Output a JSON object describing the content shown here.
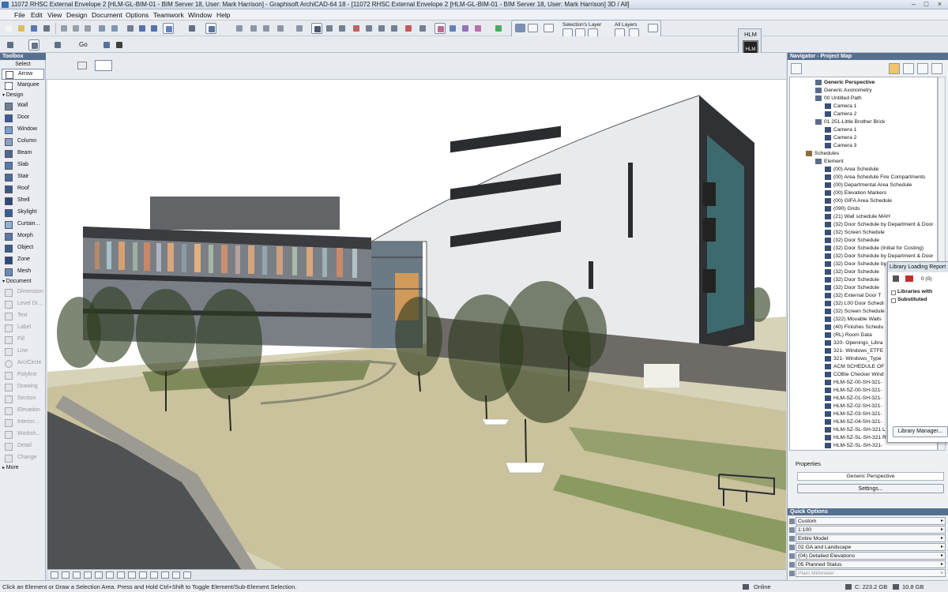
{
  "window": {
    "title": "11072 RHSC External Envelope 2 [HLM-GL-BIM-01 - BIM Server 18, User: Mark Harrison] - Graphisoft ArchiCAD-64 18 - [11072 RHSC External Envelope 2 [HLM-GL-BIM-01 - BIM Server 18, User: Mark Harrison] 3D / All]",
    "controls": [
      "–",
      "□",
      "×"
    ]
  },
  "menu": [
    "File",
    "Edit",
    "View",
    "Design",
    "Document",
    "Options",
    "Teamwork",
    "Window",
    "Help"
  ],
  "toolbar": {
    "go_label": "Go"
  },
  "layers": {
    "selections_layer": "Selection's Layer",
    "all_layers": "All Layers"
  },
  "company_badge": {
    "label": "HLM",
    "logo": "HLM"
  },
  "toolbox": {
    "header": "Toolbox",
    "select_label": "Select",
    "select_tools": [
      "Arrow",
      "Marquee"
    ],
    "design_label": "Design",
    "design_tools": [
      "Wall",
      "Door",
      "Window",
      "Column",
      "Beam",
      "Slab",
      "Stair",
      "Roof",
      "Shell",
      "Skylight",
      "Curtain...",
      "Morph",
      "Object",
      "Zone",
      "Mesh"
    ],
    "document_label": "Document",
    "document_tools": [
      "Dimension",
      "Level Di...",
      "Text",
      "Label",
      "Fill",
      "Line",
      "Arc/Circle",
      "Polyline",
      "Drawing",
      "Section",
      "Elevation",
      "Interior...",
      "Worksh...",
      "Detail",
      "Change"
    ],
    "more_label": "More"
  },
  "navigator": {
    "header": "Navigator - Project Map",
    "tree": [
      {
        "label": "Generic Perspective",
        "indent": 1,
        "bold": true
      },
      {
        "label": "Generic Axonometry",
        "indent": 1
      },
      {
        "label": "00 Untitled Path",
        "indent": 1
      },
      {
        "label": "Camera 1",
        "indent": 2
      },
      {
        "label": "Camera 2",
        "indent": 2
      },
      {
        "label": "01 251-Little Brother Brick",
        "indent": 1
      },
      {
        "label": "Camera 1",
        "indent": 2
      },
      {
        "label": "Camera 2",
        "indent": 2
      },
      {
        "label": "Camera 3",
        "indent": 2
      },
      {
        "label": "Schedules",
        "indent": 0
      },
      {
        "label": "Element",
        "indent": 1
      },
      {
        "label": "(00) Area Schedule",
        "indent": 2
      },
      {
        "label": "(00) Area Schedule Fire Compartments",
        "indent": 2
      },
      {
        "label": "(00) Departmental Area Schedule",
        "indent": 2
      },
      {
        "label": "(00) Elevation Markers",
        "indent": 2
      },
      {
        "label": "(00) GIFA Area Schedule",
        "indent": 2
      },
      {
        "label": "(090) Grids",
        "indent": 2
      },
      {
        "label": "(21) Wall schedule MAH",
        "indent": 2
      },
      {
        "label": "(32) Door Schedule by Department & Door",
        "indent": 2
      },
      {
        "label": "(32) Screen Schedule",
        "indent": 2
      },
      {
        "label": "(32) Door Schedule",
        "indent": 2
      },
      {
        "label": "(32) Door Schedule (Initial for Costing)",
        "indent": 2
      },
      {
        "label": "(32) Door Schedule by Department & Door",
        "indent": 2
      },
      {
        "label": "(32) Door Schedule by Door ID",
        "indent": 2
      },
      {
        "label": "(32) Door Schedule",
        "indent": 2
      },
      {
        "label": "(32) Door Schedule",
        "indent": 2
      },
      {
        "label": "(32) Door Schedule",
        "indent": 2
      },
      {
        "label": "(32) External Door T",
        "indent": 2
      },
      {
        "label": "(32) L00 Door Schedi",
        "indent": 2
      },
      {
        "label": "(32) Screen Schedule",
        "indent": 2
      },
      {
        "label": "(322) Movable Walls",
        "indent": 2
      },
      {
        "label": "(40) Finishes Schedu",
        "indent": 2
      },
      {
        "label": "(RL) Room Data",
        "indent": 2
      },
      {
        "label": "320- Openings_Libra",
        "indent": 2
      },
      {
        "label": "321- Windows_ETFE",
        "indent": 2
      },
      {
        "label": "321- Windows_Type",
        "indent": 2
      },
      {
        "label": "ACM SCHEDULE OF",
        "indent": 2
      },
      {
        "label": "COBie Checker Wind",
        "indent": 2
      },
      {
        "label": "HLM-SZ-00-SH-321-",
        "indent": 2
      },
      {
        "label": "HLM-SZ-00-SH-321-",
        "indent": 2
      },
      {
        "label": "HLM-SZ-01-SH-321-",
        "indent": 2
      },
      {
        "label": "HLM-SZ-02-SH-321-",
        "indent": 2
      },
      {
        "label": "HLM-SZ-03-SH-321-",
        "indent": 2
      },
      {
        "label": "HLM-SZ-04-SH-321-",
        "indent": 2
      },
      {
        "label": "HLM-SZ-SL-SH-321 L",
        "indent": 2
      },
      {
        "label": "HLM-SZ-SL-SH-321 R",
        "indent": 2
      },
      {
        "label": "HLM-SZ-SL-SH-321-",
        "indent": 2
      }
    ],
    "properties_label": "Properties",
    "properties_value": "Generic Perspective",
    "settings_button": "Settings..."
  },
  "library_report": {
    "title": "Library Loading Report",
    "count": "0 (0)",
    "rows": [
      "Libraries with",
      "Substituted"
    ],
    "manager_button": "Library Manager..."
  },
  "quick_options": {
    "header": "Quick Options",
    "fields": [
      "Custom",
      "1:100",
      "Entire Model",
      "02 GA and Landscape",
      "(04) Detailed Elevations",
      "05 Planned Status",
      "Plain Millimeter"
    ]
  },
  "status": {
    "hint": "Click an Element or Draw a Selection Area. Press and Hold Ctrl+Shift to Toggle Element/Sub-Element Selection.",
    "online": "Online",
    "disk_c": "C: 223.2 GB",
    "memory": "10.8 GB"
  }
}
